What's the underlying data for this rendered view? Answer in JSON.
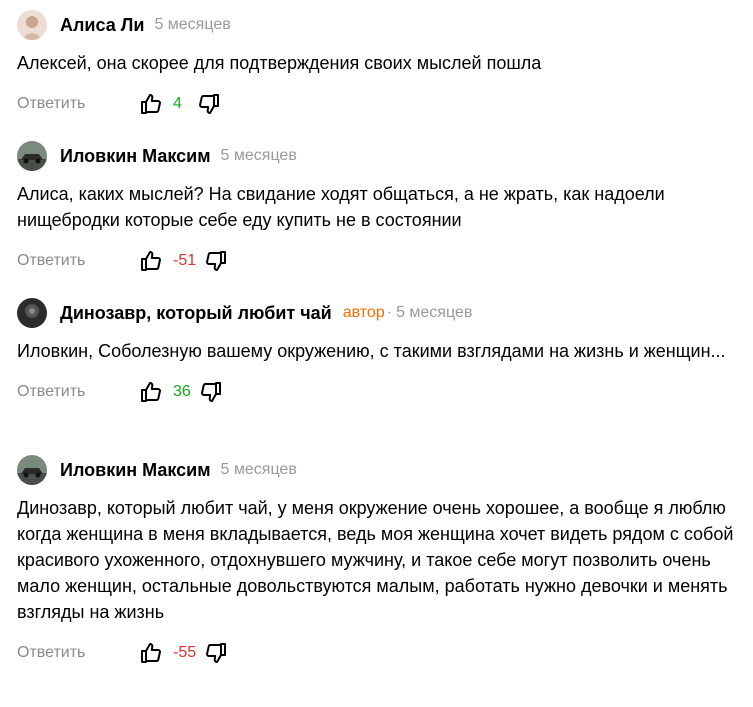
{
  "comments": [
    {
      "author": "Алиса Ли",
      "role": "",
      "time": "5 месяцев",
      "text": "Алексей, она скорее для подтверждения своих мыслей пошла",
      "reply": "Ответить",
      "score": "4",
      "score_sign": "pos",
      "avatar": "avatar-light"
    },
    {
      "author": "Иловкин Максим",
      "role": "",
      "time": "5 месяцев",
      "text": "Алиса, каких мыслей? На свидание ходят общаться, а не жрать, как надоели нищебродки которые себе еду купить не в состоянии",
      "reply": "Ответить",
      "score": "-51",
      "score_sign": "neg",
      "avatar": "avatar-car"
    },
    {
      "author": "Динозавр, который любит чай",
      "role": "автор",
      "time": "5 месяцев",
      "text": "Иловкин, Соболезную вашему окружению, с такими взглядами на жизнь и женщин...",
      "reply": "Ответить",
      "score": "36",
      "score_sign": "pos",
      "avatar": "avatar-dark"
    },
    {
      "author": "Иловкин Максим",
      "role": "",
      "time": "5 месяцев",
      "text": "Динозавр, который любит чай, у меня окружение очень хорошее, а вообще я люблю когда женщина в меня вкладывается, ведь моя женщина хочет видеть рядом с собой красивого ухоженного, отдохнувшего мужчину, и такое себе могут позволить очень мало женщин, остальные довольствуются малым, работать нужно девочки и менять взгляды на жизнь",
      "reply": "Ответить",
      "score": "-55",
      "score_sign": "neg",
      "avatar": "avatar-car"
    }
  ],
  "colors": {
    "positive": "#1aa51a",
    "negative": "#e62e2e",
    "author_role": "#ff6a00",
    "muted": "#999999"
  },
  "icons": {
    "like": "thumb-up-icon",
    "dislike": "thumb-down-icon"
  }
}
